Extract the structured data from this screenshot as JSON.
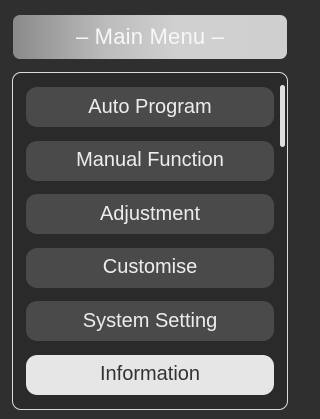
{
  "header": {
    "title": "– Main Menu –"
  },
  "menu": {
    "items": [
      {
        "label": "Auto Program",
        "selected": false
      },
      {
        "label": "Manual Function",
        "selected": false
      },
      {
        "label": "Adjustment",
        "selected": false
      },
      {
        "label": "Customise",
        "selected": false
      },
      {
        "label": "System Setting",
        "selected": false
      },
      {
        "label": "Information",
        "selected": true
      }
    ]
  },
  "colors": {
    "background": "#2f2f2f",
    "item_bg": "#4a4a4a",
    "item_selected_bg": "#e6e6e6",
    "frame_border": "#dcdcdc"
  }
}
